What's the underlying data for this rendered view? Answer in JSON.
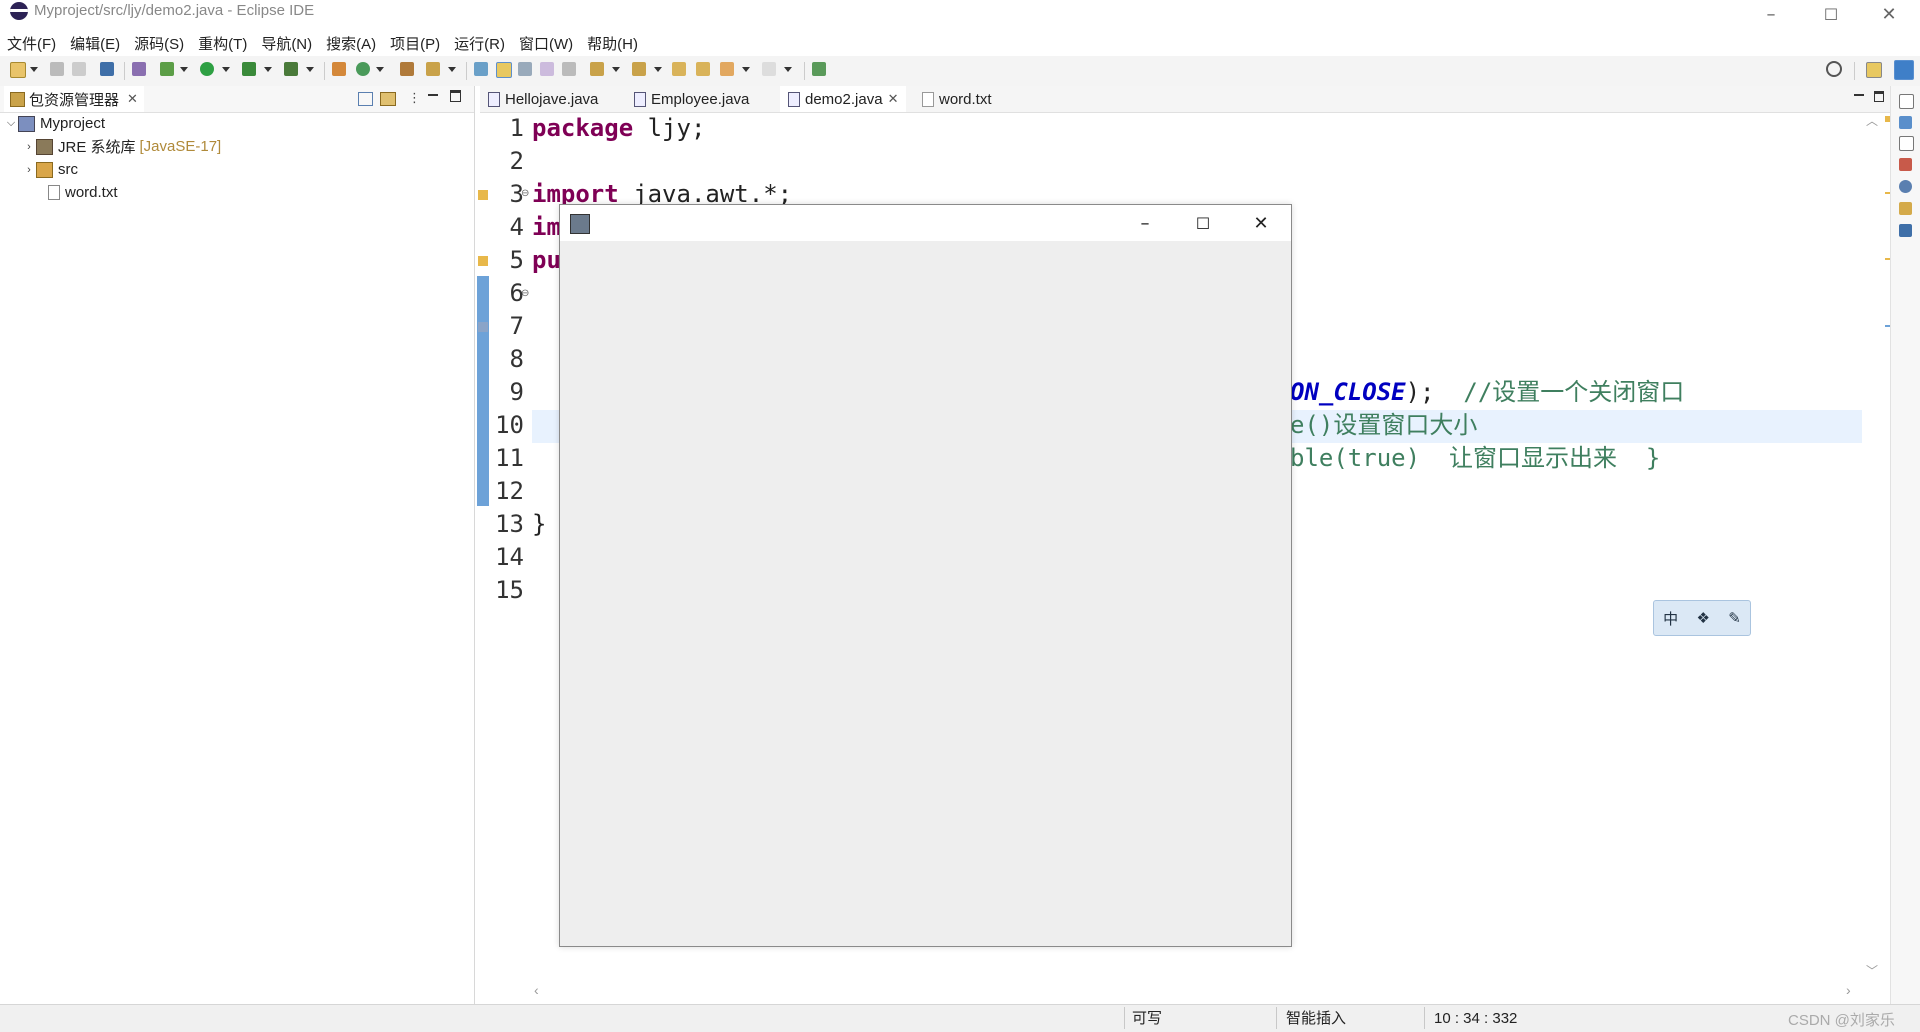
{
  "window": {
    "title": "Myproject/src/ljy/demo2.java - Eclipse IDE",
    "minimize": "–",
    "maximize": "☐",
    "close": "✕"
  },
  "menu": [
    "文件(F)",
    "编辑(E)",
    "源码(S)",
    "重构(T)",
    "导航(N)",
    "搜索(A)",
    "项目(P)",
    "运行(R)",
    "窗口(W)",
    "帮助(H)"
  ],
  "explorer": {
    "tab_label": "包资源管理器",
    "project": "Myproject",
    "jre": "JRE 系统库",
    "jre_version": "[JavaSE-17]",
    "src": "src",
    "file": "word.txt"
  },
  "editor": {
    "tabs": [
      "Hellojave.java",
      "Employee.java",
      "demo2.java",
      "word.txt"
    ],
    "active_tab": "demo2.java",
    "line_numbers": [
      "1",
      "2",
      "3",
      "4",
      "5",
      "6",
      "7",
      "8",
      "9",
      "10",
      "11",
      "12",
      "13",
      "14",
      "15"
    ],
    "line1_kw": "package",
    "line1_rest": " ljy;",
    "line3_kw": "import",
    "line3_rest": " java.awt.*;",
    "line4_kw": "im",
    "line5_kw": "pu",
    "line9_const": "ON_CLOSE",
    "line9_rest": ");  ",
    "line9_comment": "//设置一个关闭窗口",
    "line10_text": "e()设置窗口大小",
    "line11_text": "ble(true)  让窗口显示出来  }",
    "line13_text": "}"
  },
  "frame": {
    "minimize": "–",
    "maximize": "☐",
    "close": "✕"
  },
  "ime": [
    "中",
    "❖",
    "✎"
  ],
  "status": {
    "writable": "可写",
    "insert_mode": "智能插入",
    "position": "10 : 34 : 332",
    "watermark": "CSDN @刘家乐"
  },
  "colors": {
    "keyword": "#7f0055",
    "constant": "#0000c0",
    "comment": "#3f7f5f",
    "ruler": "#6da2d8",
    "current_line": "#e8f2fe"
  }
}
